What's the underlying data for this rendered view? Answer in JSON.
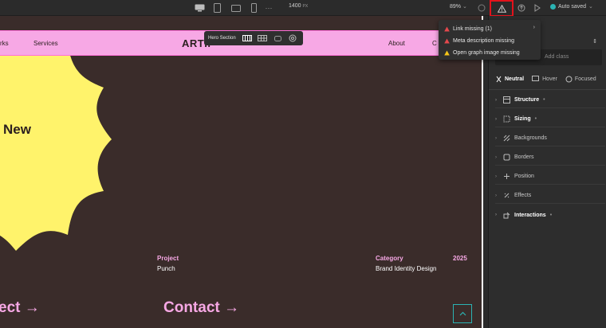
{
  "toolbar": {
    "width_label": "1400",
    "width_unit": "PX",
    "zoom": "89%",
    "status": "Auto saved",
    "status_color": "#2bb3b3"
  },
  "site": {
    "nav_left": [
      "rks",
      "Services"
    ],
    "brand": "ARTIF",
    "nav_right": [
      "About",
      "C"
    ],
    "hero_label": "Hero Section",
    "hero_text": "New",
    "project_label": "Project",
    "project_value": "Punch",
    "category_label": "Category",
    "category_value": "Brand Identity Design",
    "year": "2025",
    "link_left": "ect",
    "link_contact": "Contact",
    "arrow": "→"
  },
  "issues": [
    {
      "label": "Link missing (1)",
      "severity": "error",
      "color": "#e5484d"
    },
    {
      "label": "Meta description missing",
      "severity": "error",
      "color": "#e5484d"
    },
    {
      "label": "Open graph image missing",
      "severity": "warning",
      "color": "#f5c518"
    }
  ],
  "panel": {
    "add_class_placeholder": "Add class",
    "states": [
      "Neutral",
      "Hover",
      "Focused"
    ],
    "sections": [
      {
        "label": "Structure",
        "bold": true,
        "dot": "•",
        "icon": "structure-icon"
      },
      {
        "label": "Sizing",
        "bold": true,
        "dot": "•",
        "icon": "sizing-icon"
      },
      {
        "label": "Backgrounds",
        "bold": false,
        "dot": "",
        "icon": "backgrounds-icon"
      },
      {
        "label": "Borders",
        "bold": false,
        "dot": "",
        "icon": "borders-icon"
      },
      {
        "label": "Position",
        "bold": false,
        "dot": "",
        "icon": "position-icon"
      },
      {
        "label": "Effects",
        "bold": false,
        "dot": "",
        "icon": "effects-icon"
      },
      {
        "label": "Interactions",
        "bold": true,
        "dot": "•",
        "icon": "interactions-icon"
      }
    ]
  },
  "colors": {
    "nav_pink": "#f7a8e5",
    "canvas_bg": "#3a2c2a",
    "flower_yellow": "#fff36b",
    "highlight_red": "#e3121b"
  }
}
